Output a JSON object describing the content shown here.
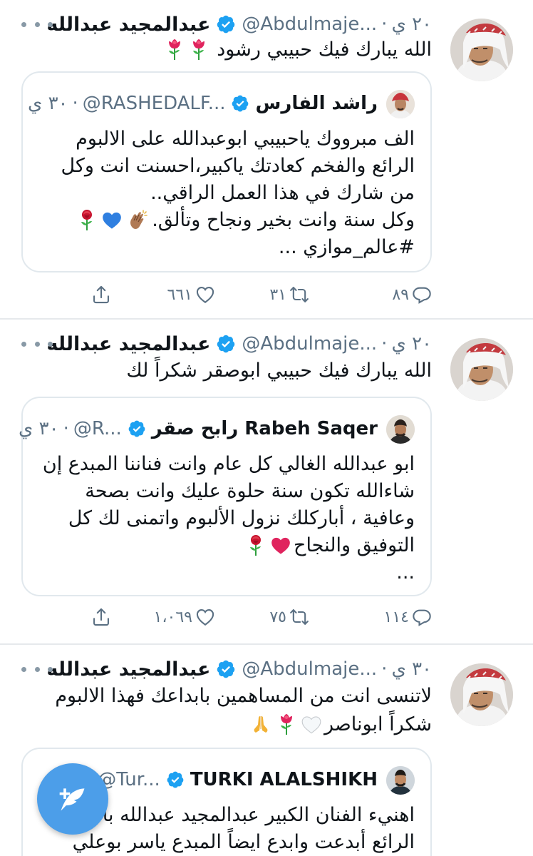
{
  "tweets": [
    {
      "author": "عبدالمجيد عبدالله",
      "handle": "@Abdulmaje...",
      "separator": "·",
      "time": "٢٠ ي",
      "text": "الله يبارك فيك حبيبي رشود",
      "emoji": [
        "rose",
        "rose"
      ],
      "quote": {
        "author": "راشد الفارس",
        "handle": "@RASHEDALF...",
        "separator": "·",
        "time": "٣٠ ي",
        "lines": [
          "الف مبرووك ياحبيبي ابوعبدالله على الالبوم",
          "الرائع والفخم كعادتك ياكبير،احسنت انت وكل",
          "من شارك في هذا العمل الراقي..",
          "وكل سنة وانت بخير ونجاح وتألق.",
          "#عالم_موازي ..."
        ]
      },
      "actions": {
        "replies": "٨٩",
        "retweets": "٣١",
        "likes": "٦٦١"
      }
    },
    {
      "author": "عبدالمجيد عبدالله",
      "handle": "@Abdulmaje...",
      "separator": "·",
      "time": "٢٠ ي",
      "text": "الله يبارك فيك حبيبي ابوصقر شكراً لك",
      "quote": {
        "author": "رابح صقر Rabeh Saqer",
        "handle": "@R...",
        "separator": "·",
        "time": "٣٠ ي",
        "lines": [
          "ابو عبدالله الغالي كل عام وانت فناننا المبدع إن",
          "شاءالله تكون سنة حلوة عليك وانت بصحة",
          "وعافية ، أباركلك نزول الألبوم واتمنى لك كل",
          "التوفيق والنجاح",
          "..."
        ]
      },
      "actions": {
        "replies": "١١٤",
        "retweets": "٧٥",
        "likes": "١،٠٦٩"
      }
    },
    {
      "author": "عبدالمجيد عبدالله",
      "handle": "@Abdulmaje...",
      "separator": "·",
      "time": "٣٠ ي",
      "lines": [
        "لاتنسى انت من المساهمين بابداعك فهذا الالبوم",
        "شكراً ابوناصر"
      ],
      "quote": {
        "author": "TURKI ALALSHIKH",
        "handle": "@Tur...",
        "separator": "·",
        "lines": [
          "اهنيء الفنان الكبير عبدالمجيد عبدالله بألبومه",
          "الرائع أبدعت وابدع ايضاً المبدع ياسر بوعلي"
        ]
      }
    }
  ],
  "colors": {
    "verified": "#1da1f2",
    "secondary_text": "#5b7083",
    "fab": "#4c9ee9",
    "divider": "#e6e9ec"
  },
  "icons": [
    "more-icon",
    "verified-badge-icon",
    "reply-icon",
    "retweet-icon",
    "like-icon",
    "share-icon",
    "compose-tweet-icon"
  ]
}
